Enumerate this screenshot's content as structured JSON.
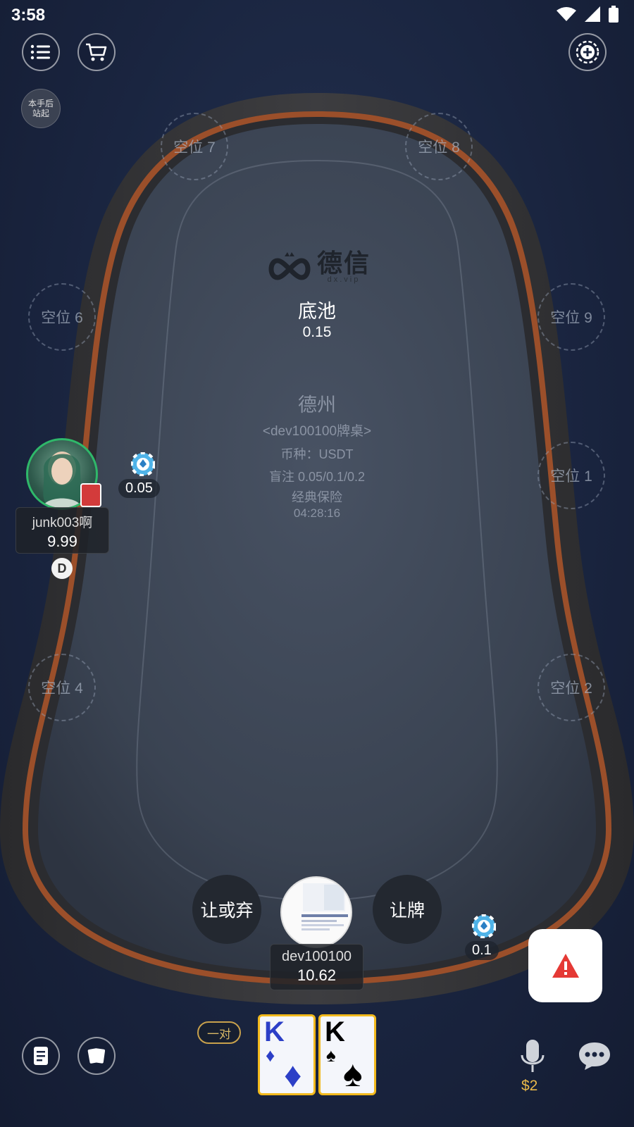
{
  "status_bar": {
    "time": "3:58"
  },
  "standup": {
    "label_line1": "本手后",
    "label_line2": "站起"
  },
  "table": {
    "logo_text": "德信",
    "logo_sub": "dx.vip",
    "pot_label": "底池",
    "pot_value": "0.15",
    "game_name": "德州",
    "table_name": "<dev100100牌桌>",
    "currency": "币种：USDT",
    "blinds": "盲注 0.05/0.1/0.2",
    "insurance": "经典保险",
    "timer": "04:28:16"
  },
  "seats": {
    "s7": "空位 7",
    "s8": "空位 8",
    "s6": "空位 6",
    "s9": "空位 9",
    "s1": "空位 1",
    "s4": "空位 4",
    "s2": "空位 2"
  },
  "opponent": {
    "name": "junk003啊",
    "stack": "9.99",
    "bet": "0.05",
    "dealer_label": "D"
  },
  "hero": {
    "name": "dev100100",
    "stack": "10.62",
    "bet": "0.1",
    "hand_rank": "一对",
    "cards": [
      {
        "rank": "K",
        "suit": "♦",
        "color": "#2c3fc7"
      },
      {
        "rank": "K",
        "suit": "♠",
        "color": "#000000"
      }
    ]
  },
  "actions": {
    "check_or_fold": "让或弃",
    "check": "让牌"
  },
  "voice": {
    "cost": "$2"
  },
  "colors": {
    "felt": "#3a4352",
    "rail_wood": "#a0522d",
    "card_border": "#f2b91c",
    "alert_red": "#e53935",
    "cost_gold": "#e8b84a"
  }
}
